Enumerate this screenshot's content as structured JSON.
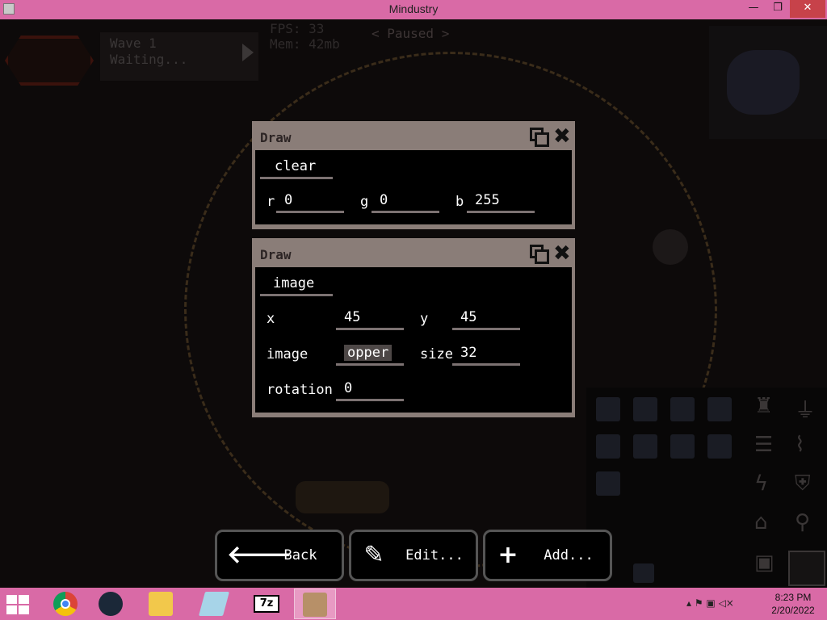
{
  "window": {
    "title": "Mindustry",
    "min_symbol": "—",
    "max_symbol": "❐",
    "close_symbol": "✕"
  },
  "hud": {
    "wave_title": "Wave 1",
    "wave_status": "Waiting...",
    "fps": "FPS: 33",
    "mem": "Mem: 42mb",
    "paused": "< Paused >"
  },
  "panels": [
    {
      "header": "Draw",
      "op": "clear",
      "r_label": "r",
      "r_value": "0",
      "g_label": "g",
      "g_value": "0",
      "b_label": "b",
      "b_value": "255"
    },
    {
      "header": "Draw",
      "op": "image",
      "x_label": "x",
      "x_value": "45",
      "y_label": "y",
      "y_value": "45",
      "image_label": "image",
      "image_value": "opper",
      "size_label": "size",
      "size_value": "32",
      "rotation_label": "rotation",
      "rotation_value": "0"
    }
  ],
  "buttons": {
    "back_icon": "🡐",
    "back": "Back",
    "edit_icon": "✎",
    "edit": "Edit...",
    "add_icon": "+",
    "add": "Add..."
  },
  "taskbar": {
    "apps": [
      "chrome",
      "steam",
      "file-explorer",
      "notepad",
      "7-zip",
      "mindustry"
    ],
    "sevenzip_label": "7z",
    "tray_icons": "▴  ⚑  ▣  ◁×",
    "time": "8:23 PM",
    "date": "2/20/2022"
  },
  "colors": {
    "titlebar": "#d96aa6",
    "panel_frame": "#8a7d78",
    "close_button": "#c7424a"
  }
}
